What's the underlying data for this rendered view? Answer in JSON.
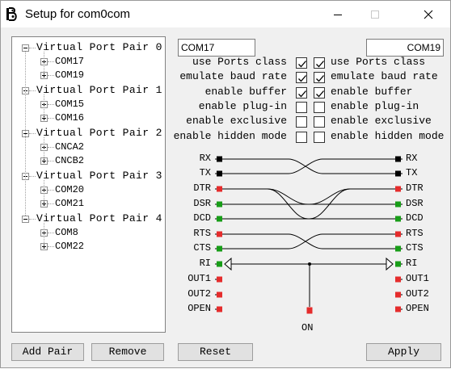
{
  "window": {
    "title": "Setup for com0com"
  },
  "tree": {
    "pairs": [
      {
        "label": "Virtual Port Pair 0",
        "ports": [
          "COM17",
          "COM19"
        ]
      },
      {
        "label": "Virtual Port Pair 1",
        "ports": [
          "COM15",
          "COM16"
        ]
      },
      {
        "label": "Virtual Port Pair 2",
        "ports": [
          "CNCA2",
          "CNCB2"
        ]
      },
      {
        "label": "Virtual Port Pair 3",
        "ports": [
          "COM20",
          "COM21"
        ]
      },
      {
        "label": "Virtual Port Pair 4",
        "ports": [
          "COM8",
          "COM22"
        ]
      }
    ]
  },
  "ports": {
    "left_name": "COM17",
    "right_name": "COM19"
  },
  "options": [
    {
      "label": "use Ports class",
      "left_checked": true,
      "right_checked": true
    },
    {
      "label": "emulate baud rate",
      "left_checked": true,
      "right_checked": true
    },
    {
      "label": "enable buffer",
      "left_checked": true,
      "right_checked": true
    },
    {
      "label": "enable plug-in",
      "left_checked": false,
      "right_checked": false
    },
    {
      "label": "enable exclusive",
      "left_checked": false,
      "right_checked": false
    },
    {
      "label": "enable hidden mode",
      "left_checked": false,
      "right_checked": false
    }
  ],
  "signals": {
    "left": [
      {
        "label": "RX",
        "color": "black"
      },
      {
        "label": "TX",
        "color": "black"
      },
      {
        "label": "DTR",
        "color": "red"
      },
      {
        "label": "DSR",
        "color": "green"
      },
      {
        "label": "DCD",
        "color": "green"
      },
      {
        "label": "RTS",
        "color": "red"
      },
      {
        "label": "CTS",
        "color": "green"
      },
      {
        "label": "RI",
        "color": "green"
      },
      {
        "label": "OUT1",
        "color": "red"
      },
      {
        "label": "OUT2",
        "color": "red"
      },
      {
        "label": "OPEN",
        "color": "red"
      }
    ],
    "right": [
      {
        "label": "RX",
        "color": "black"
      },
      {
        "label": "TX",
        "color": "black"
      },
      {
        "label": "DTR",
        "color": "red"
      },
      {
        "label": "DSR",
        "color": "green"
      },
      {
        "label": "DCD",
        "color": "green"
      },
      {
        "label": "RTS",
        "color": "red"
      },
      {
        "label": "CTS",
        "color": "green"
      },
      {
        "label": "RI",
        "color": "green"
      },
      {
        "label": "OUT1",
        "color": "red"
      },
      {
        "label": "OUT2",
        "color": "red"
      },
      {
        "label": "OPEN",
        "color": "red"
      }
    ],
    "on_label": "ON"
  },
  "buttons": {
    "add_pair": "Add Pair",
    "remove": "Remove",
    "reset": "Reset",
    "apply": "Apply"
  },
  "colors": {
    "red": "#e52c2c",
    "green": "#189d18",
    "black": "#000000"
  }
}
